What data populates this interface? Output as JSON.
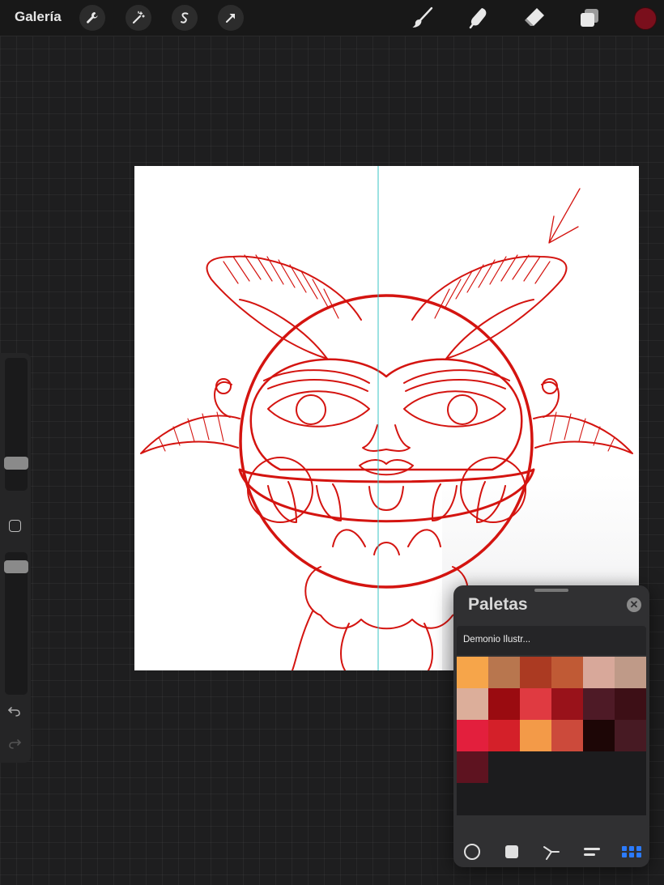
{
  "topbar": {
    "gallery_label": "Galería",
    "icons": [
      "wrench-icon",
      "magic-wand-icon",
      "selection-icon",
      "move-arrow-icon"
    ],
    "tools": [
      "brush-icon",
      "smudge-icon",
      "eraser-icon",
      "layers-icon"
    ],
    "current_color": "#7a0f1c"
  },
  "sidebar": {
    "brush_size_level": 0.25,
    "opacity_level": 0.95
  },
  "palettes_panel": {
    "title": "Paletas",
    "close_icon": "close-icon",
    "palette_name": "Demonio Ilustr...",
    "swatches": [
      "#f6a54a",
      "#b8764e",
      "#ab3a22",
      "#c05a35",
      "#d8a89a",
      "#bf9a88",
      "#dcae9a",
      "#9a0b10",
      "#e03a41",
      "#99121a",
      "#4e1a26",
      "#3d0f16",
      "#e31f3d",
      "#d42029",
      "#f39a48",
      "#cc4a3b",
      "#1d0606",
      "#471a23",
      "#5e1320"
    ],
    "view_modes": [
      "disc-icon",
      "classic-icon",
      "harmony-icon",
      "value-icon",
      "palettes-icon"
    ],
    "active_mode": "palettes-icon"
  }
}
